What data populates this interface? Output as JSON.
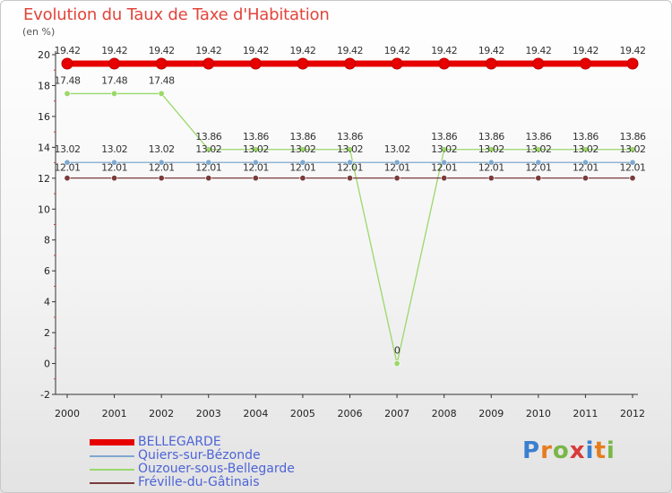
{
  "title": "Evolution du Taux de Taxe d'Habitation",
  "unit_label": "(en %)",
  "logo": {
    "letters": [
      "P",
      "r",
      "o",
      "x",
      "i",
      "t",
      "i"
    ],
    "colors": [
      "#3a7fd0",
      "#e67c1f",
      "#7ab648",
      "#d83a3a",
      "#3a7fd0",
      "#e67c1f",
      "#7ab648"
    ]
  },
  "chart_data": {
    "type": "line",
    "title": "Evolution du Taux de Taxe d'Habitation",
    "ylabel": "(en %)",
    "xlabel": "",
    "x": [
      "2000",
      "2001",
      "2002",
      "2003",
      "2004",
      "2005",
      "2006",
      "2007",
      "2008",
      "2009",
      "2010",
      "2011",
      "2012"
    ],
    "ylim": [
      -2,
      20
    ],
    "yticks": [
      -2,
      0,
      2,
      4,
      6,
      8,
      10,
      12,
      14,
      16,
      18,
      20
    ],
    "grid": false,
    "legend_position": "bottom-left",
    "series": [
      {
        "name": "BELLEGARDE",
        "color": "#e60000",
        "values": [
          19.42,
          19.42,
          19.42,
          19.42,
          19.42,
          19.42,
          19.42,
          19.42,
          19.42,
          19.42,
          19.42,
          19.42,
          19.42
        ],
        "labels": [
          "19.42",
          "19.42",
          "19.42",
          "19.42",
          "19.42",
          "19.42",
          "19.42",
          "19.42",
          "19.42",
          "19.42",
          "19.42",
          "19.42",
          "19.42"
        ]
      },
      {
        "name": "Quiers-sur-Bézonde",
        "color": "#7fa8cf",
        "values": [
          13.02,
          13.02,
          13.02,
          13.02,
          13.02,
          13.02,
          13.02,
          13.02,
          13.02,
          13.02,
          13.02,
          13.02,
          13.02
        ],
        "labels": [
          "13.02",
          "13.02",
          "13.02",
          "13.02",
          "13.02",
          "13.02",
          "13.02",
          "13.02",
          "13.02",
          "13.02",
          "13.02",
          "13.02",
          "13.02"
        ]
      },
      {
        "name": "Ouzouer-sous-Bellegarde",
        "color": "#9bd86a",
        "values": [
          17.48,
          17.48,
          17.48,
          13.86,
          13.86,
          13.86,
          13.86,
          0,
          13.86,
          13.86,
          13.86,
          13.86,
          13.86
        ],
        "labels": [
          "17.48",
          "17.48",
          "17.48",
          "13.86",
          "13.86",
          "13.86",
          "13.86",
          "0",
          "13.86",
          "13.86",
          "13.86",
          "13.86",
          "13.86"
        ]
      },
      {
        "name": "Fréville-du-Gâtinais",
        "color": "#7a3b3b",
        "values": [
          12.01,
          12.01,
          12.01,
          12.01,
          12.01,
          12.01,
          12.01,
          12.01,
          12.01,
          12.01,
          12.01,
          12.01,
          12.01
        ],
        "labels": [
          "12.01",
          "12.01",
          "12.01",
          "12.01",
          "12.01",
          "12.01",
          "12.01",
          "12.01",
          "12.01",
          "12.01",
          "12.01",
          "12.01",
          "12.01"
        ]
      }
    ]
  }
}
